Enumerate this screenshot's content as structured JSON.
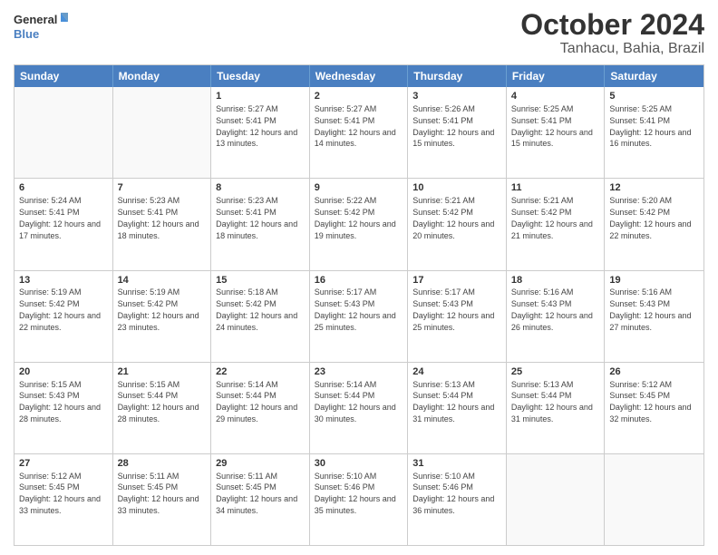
{
  "logo": {
    "text_general": "General",
    "text_blue": "Blue"
  },
  "title": "October 2024",
  "subtitle": "Tanhacu, Bahia, Brazil",
  "headers": [
    "Sunday",
    "Monday",
    "Tuesday",
    "Wednesday",
    "Thursday",
    "Friday",
    "Saturday"
  ],
  "rows": [
    [
      {
        "day": "",
        "sunrise": "",
        "sunset": "",
        "daylight": "",
        "empty": true
      },
      {
        "day": "",
        "sunrise": "",
        "sunset": "",
        "daylight": "",
        "empty": true
      },
      {
        "day": "1",
        "sunrise": "Sunrise: 5:27 AM",
        "sunset": "Sunset: 5:41 PM",
        "daylight": "Daylight: 12 hours and 13 minutes."
      },
      {
        "day": "2",
        "sunrise": "Sunrise: 5:27 AM",
        "sunset": "Sunset: 5:41 PM",
        "daylight": "Daylight: 12 hours and 14 minutes."
      },
      {
        "day": "3",
        "sunrise": "Sunrise: 5:26 AM",
        "sunset": "Sunset: 5:41 PM",
        "daylight": "Daylight: 12 hours and 15 minutes."
      },
      {
        "day": "4",
        "sunrise": "Sunrise: 5:25 AM",
        "sunset": "Sunset: 5:41 PM",
        "daylight": "Daylight: 12 hours and 15 minutes."
      },
      {
        "day": "5",
        "sunrise": "Sunrise: 5:25 AM",
        "sunset": "Sunset: 5:41 PM",
        "daylight": "Daylight: 12 hours and 16 minutes."
      }
    ],
    [
      {
        "day": "6",
        "sunrise": "Sunrise: 5:24 AM",
        "sunset": "Sunset: 5:41 PM",
        "daylight": "Daylight: 12 hours and 17 minutes."
      },
      {
        "day": "7",
        "sunrise": "Sunrise: 5:23 AM",
        "sunset": "Sunset: 5:41 PM",
        "daylight": "Daylight: 12 hours and 18 minutes."
      },
      {
        "day": "8",
        "sunrise": "Sunrise: 5:23 AM",
        "sunset": "Sunset: 5:41 PM",
        "daylight": "Daylight: 12 hours and 18 minutes."
      },
      {
        "day": "9",
        "sunrise": "Sunrise: 5:22 AM",
        "sunset": "Sunset: 5:42 PM",
        "daylight": "Daylight: 12 hours and 19 minutes."
      },
      {
        "day": "10",
        "sunrise": "Sunrise: 5:21 AM",
        "sunset": "Sunset: 5:42 PM",
        "daylight": "Daylight: 12 hours and 20 minutes."
      },
      {
        "day": "11",
        "sunrise": "Sunrise: 5:21 AM",
        "sunset": "Sunset: 5:42 PM",
        "daylight": "Daylight: 12 hours and 21 minutes."
      },
      {
        "day": "12",
        "sunrise": "Sunrise: 5:20 AM",
        "sunset": "Sunset: 5:42 PM",
        "daylight": "Daylight: 12 hours and 22 minutes."
      }
    ],
    [
      {
        "day": "13",
        "sunrise": "Sunrise: 5:19 AM",
        "sunset": "Sunset: 5:42 PM",
        "daylight": "Daylight: 12 hours and 22 minutes."
      },
      {
        "day": "14",
        "sunrise": "Sunrise: 5:19 AM",
        "sunset": "Sunset: 5:42 PM",
        "daylight": "Daylight: 12 hours and 23 minutes."
      },
      {
        "day": "15",
        "sunrise": "Sunrise: 5:18 AM",
        "sunset": "Sunset: 5:42 PM",
        "daylight": "Daylight: 12 hours and 24 minutes."
      },
      {
        "day": "16",
        "sunrise": "Sunrise: 5:17 AM",
        "sunset": "Sunset: 5:43 PM",
        "daylight": "Daylight: 12 hours and 25 minutes."
      },
      {
        "day": "17",
        "sunrise": "Sunrise: 5:17 AM",
        "sunset": "Sunset: 5:43 PM",
        "daylight": "Daylight: 12 hours and 25 minutes."
      },
      {
        "day": "18",
        "sunrise": "Sunrise: 5:16 AM",
        "sunset": "Sunset: 5:43 PM",
        "daylight": "Daylight: 12 hours and 26 minutes."
      },
      {
        "day": "19",
        "sunrise": "Sunrise: 5:16 AM",
        "sunset": "Sunset: 5:43 PM",
        "daylight": "Daylight: 12 hours and 27 minutes."
      }
    ],
    [
      {
        "day": "20",
        "sunrise": "Sunrise: 5:15 AM",
        "sunset": "Sunset: 5:43 PM",
        "daylight": "Daylight: 12 hours and 28 minutes."
      },
      {
        "day": "21",
        "sunrise": "Sunrise: 5:15 AM",
        "sunset": "Sunset: 5:44 PM",
        "daylight": "Daylight: 12 hours and 28 minutes."
      },
      {
        "day": "22",
        "sunrise": "Sunrise: 5:14 AM",
        "sunset": "Sunset: 5:44 PM",
        "daylight": "Daylight: 12 hours and 29 minutes."
      },
      {
        "day": "23",
        "sunrise": "Sunrise: 5:14 AM",
        "sunset": "Sunset: 5:44 PM",
        "daylight": "Daylight: 12 hours and 30 minutes."
      },
      {
        "day": "24",
        "sunrise": "Sunrise: 5:13 AM",
        "sunset": "Sunset: 5:44 PM",
        "daylight": "Daylight: 12 hours and 31 minutes."
      },
      {
        "day": "25",
        "sunrise": "Sunrise: 5:13 AM",
        "sunset": "Sunset: 5:44 PM",
        "daylight": "Daylight: 12 hours and 31 minutes."
      },
      {
        "day": "26",
        "sunrise": "Sunrise: 5:12 AM",
        "sunset": "Sunset: 5:45 PM",
        "daylight": "Daylight: 12 hours and 32 minutes."
      }
    ],
    [
      {
        "day": "27",
        "sunrise": "Sunrise: 5:12 AM",
        "sunset": "Sunset: 5:45 PM",
        "daylight": "Daylight: 12 hours and 33 minutes."
      },
      {
        "day": "28",
        "sunrise": "Sunrise: 5:11 AM",
        "sunset": "Sunset: 5:45 PM",
        "daylight": "Daylight: 12 hours and 33 minutes."
      },
      {
        "day": "29",
        "sunrise": "Sunrise: 5:11 AM",
        "sunset": "Sunset: 5:45 PM",
        "daylight": "Daylight: 12 hours and 34 minutes."
      },
      {
        "day": "30",
        "sunrise": "Sunrise: 5:10 AM",
        "sunset": "Sunset: 5:46 PM",
        "daylight": "Daylight: 12 hours and 35 minutes."
      },
      {
        "day": "31",
        "sunrise": "Sunrise: 5:10 AM",
        "sunset": "Sunset: 5:46 PM",
        "daylight": "Daylight: 12 hours and 36 minutes."
      },
      {
        "day": "",
        "sunrise": "",
        "sunset": "",
        "daylight": "",
        "empty": true
      },
      {
        "day": "",
        "sunrise": "",
        "sunset": "",
        "daylight": "",
        "empty": true
      }
    ]
  ]
}
